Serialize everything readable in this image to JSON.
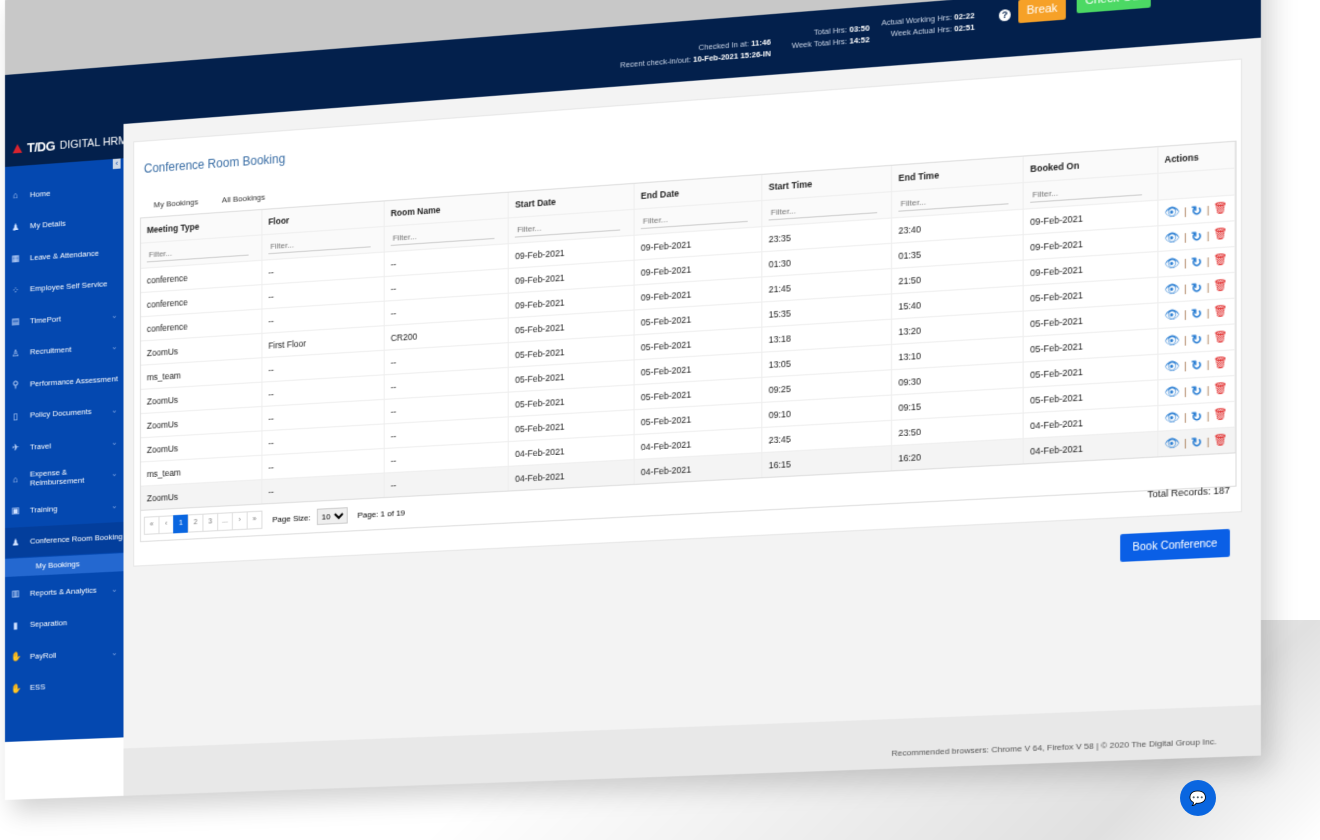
{
  "app": {
    "brand": "T/DG",
    "product": "DIGITAL HRMS"
  },
  "topbar": {
    "checked_in_label": "Checked In at:",
    "checked_in_value": "11:46",
    "recent_label": "Recent check-in/out:",
    "recent_value": "10-Feb-2021 15:26-IN",
    "total_hrs_label": "Total Hrs:",
    "total_hrs_value": "03:50",
    "week_total_label": "Week Total Hrs:",
    "week_total_value": "14:52",
    "actual_label": "Actual Working Hrs:",
    "actual_value": "02:22",
    "week_actual_label": "Week Actual Hrs:",
    "week_actual_value": "02:51",
    "help": "?",
    "break_label": "Break",
    "checkout_label": "Check-Out"
  },
  "sidebar": {
    "items": [
      {
        "label": "Home",
        "icon": "⌂",
        "chev": ""
      },
      {
        "label": "My Details",
        "icon": "♟",
        "chev": ""
      },
      {
        "label": "Leave & Attendance",
        "icon": "▦",
        "chev": ""
      },
      {
        "label": "Employee Self Service",
        "icon": "⁘",
        "chev": ""
      },
      {
        "label": "TimePort",
        "icon": "▤",
        "chev": "⌄"
      },
      {
        "label": "Recruitment",
        "icon": "♙",
        "chev": "⌄"
      },
      {
        "label": "Performance Assessment",
        "icon": "⚲",
        "chev": ""
      },
      {
        "label": "Policy Documents",
        "icon": "▯",
        "chev": "⌄"
      },
      {
        "label": "Travel",
        "icon": "✈",
        "chev": "⌄"
      },
      {
        "label": "Expense & Reimbursement",
        "icon": "⌂",
        "chev": "⌄"
      },
      {
        "label": "Training",
        "icon": "▣",
        "chev": "⌄"
      },
      {
        "label": "Conference Room Booking",
        "icon": "♟",
        "chev": "⌄"
      },
      {
        "label": "Reports & Analytics",
        "icon": "▥",
        "chev": "⌄"
      },
      {
        "label": "Separation",
        "icon": "▮",
        "chev": ""
      },
      {
        "label": "PayRoll",
        "icon": "✋",
        "chev": "⌄"
      },
      {
        "label": "ESS",
        "icon": "✋",
        "chev": ""
      }
    ],
    "sub_item": "My Bookings"
  },
  "page": {
    "title": "Conference Room Booking",
    "tabs": [
      "My Bookings",
      "All Bookings"
    ],
    "columns": [
      "Meeting Type",
      "Floor",
      "Room Name",
      "Start Date",
      "End Date",
      "Start Time",
      "End Time",
      "Booked On",
      "Actions"
    ],
    "filter_placeholder": "Filter...",
    "rows": [
      [
        "conference",
        "--",
        "--",
        "09-Feb-2021",
        "09-Feb-2021",
        "23:35",
        "23:40",
        "09-Feb-2021"
      ],
      [
        "conference",
        "--",
        "--",
        "09-Feb-2021",
        "09-Feb-2021",
        "01:30",
        "01:35",
        "09-Feb-2021"
      ],
      [
        "conference",
        "--",
        "--",
        "09-Feb-2021",
        "09-Feb-2021",
        "21:45",
        "21:50",
        "09-Feb-2021"
      ],
      [
        "ZoomUs",
        "First Floor",
        "CR200",
        "05-Feb-2021",
        "05-Feb-2021",
        "15:35",
        "15:40",
        "05-Feb-2021"
      ],
      [
        "ms_team",
        "--",
        "--",
        "05-Feb-2021",
        "05-Feb-2021",
        "13:18",
        "13:20",
        "05-Feb-2021"
      ],
      [
        "ZoomUs",
        "--",
        "--",
        "05-Feb-2021",
        "05-Feb-2021",
        "13:05",
        "13:10",
        "05-Feb-2021"
      ],
      [
        "ZoomUs",
        "--",
        "--",
        "05-Feb-2021",
        "05-Feb-2021",
        "09:25",
        "09:30",
        "05-Feb-2021"
      ],
      [
        "ZoomUs",
        "--",
        "--",
        "05-Feb-2021",
        "05-Feb-2021",
        "09:10",
        "09:15",
        "05-Feb-2021"
      ],
      [
        "ms_team",
        "--",
        "--",
        "04-Feb-2021",
        "04-Feb-2021",
        "23:45",
        "23:50",
        "04-Feb-2021"
      ],
      [
        "ZoomUs",
        "--",
        "--",
        "04-Feb-2021",
        "04-Feb-2021",
        "16:15",
        "16:20",
        "04-Feb-2021"
      ]
    ],
    "actions": {
      "view": "👁",
      "sep": "|",
      "reschedule": "↻",
      "delete": "🗑"
    },
    "pager": {
      "first": "«",
      "prev": "‹",
      "pages": [
        "1",
        "2",
        "3",
        "..."
      ],
      "next": "›",
      "last": "»",
      "active": "1",
      "page_size_label": "Page Size:",
      "page_size": "10",
      "page_info": "Page: 1 of 19"
    },
    "total_records": "Total Records: 187",
    "book_button": "Book Conference"
  },
  "footer": {
    "text": "Recommended browsers: Chrome V 64, Firefox V 58  |  © 2020 The Digital Group Inc."
  },
  "colors": {
    "topbar": "#03204c",
    "sidebar": "#0448b0",
    "break": "#f6a128",
    "checkout": "#4cd964",
    "primary": "#0a5fe6"
  }
}
